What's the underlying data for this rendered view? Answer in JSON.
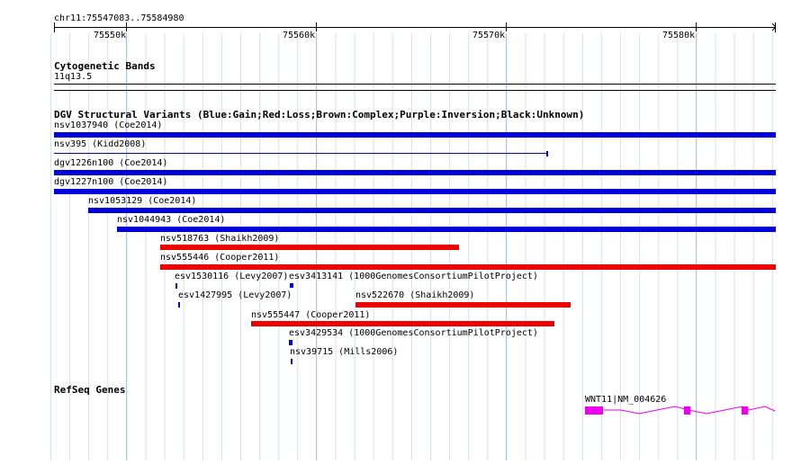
{
  "ruler": {
    "location": "chr11:75547083..75584980",
    "ticks": [
      "75550k",
      "75560k",
      "75570k",
      "75580k"
    ]
  },
  "cytoband_track": {
    "title": "Cytogenetic Bands",
    "band": "11q13.5"
  },
  "dgv_track": {
    "title": "DGV Structural Variants (Blue:Gain;Red:Loss;Brown:Complex;Purple:Inversion;Black:Unknown)",
    "features": [
      {
        "id": "nsv1037940",
        "label": "nsv1037940 (Coe2014)",
        "type": "gain"
      },
      {
        "id": "nsv395",
        "label": "nsv395 (Kidd2008)",
        "type": "gain"
      },
      {
        "id": "dgv1226n100",
        "label": "dgv1226n100 (Coe2014)",
        "type": "gain"
      },
      {
        "id": "dgv1227n100",
        "label": "dgv1227n100 (Coe2014)",
        "type": "gain"
      },
      {
        "id": "nsv1053129",
        "label": "nsv1053129 (Coe2014)",
        "type": "gain"
      },
      {
        "id": "nsv1044943",
        "label": "nsv1044943 (Coe2014)",
        "type": "gain"
      },
      {
        "id": "nsv518763",
        "label": "nsv518763 (Shaikh2009)",
        "type": "loss"
      },
      {
        "id": "nsv555446",
        "label": "nsv555446 (Cooper2011)",
        "type": "loss"
      },
      {
        "id": "esv1530116",
        "label": "esv1530116 (Levy2007)",
        "type": "gain"
      },
      {
        "id": "esv3413141",
        "label": "esv3413141 (1000GenomesConsortiumPilotProject)",
        "type": "gain"
      },
      {
        "id": "esv1427995",
        "label": "esv1427995 (Levy2007)",
        "type": "gain"
      },
      {
        "id": "nsv522670",
        "label": "nsv522670 (Shaikh2009)",
        "type": "loss"
      },
      {
        "id": "nsv555447",
        "label": "nsv555447 (Cooper2011)",
        "type": "loss"
      },
      {
        "id": "esv3429534",
        "label": "esv3429534 (1000GenomesConsortiumPilotProject)",
        "type": "gain"
      },
      {
        "id": "nsv39715",
        "label": "nsv39715 (Mills2006)",
        "type": "gain"
      }
    ]
  },
  "refseq_track": {
    "title": "RefSeq Genes",
    "gene_label": "WNT11|NM_004626"
  },
  "colors": {
    "gain": "#0000dd",
    "loss": "#ee0000",
    "gene": "#ee00ee",
    "grid_major": "#b0c4de",
    "grid_minor": "#d3e2f2"
  }
}
